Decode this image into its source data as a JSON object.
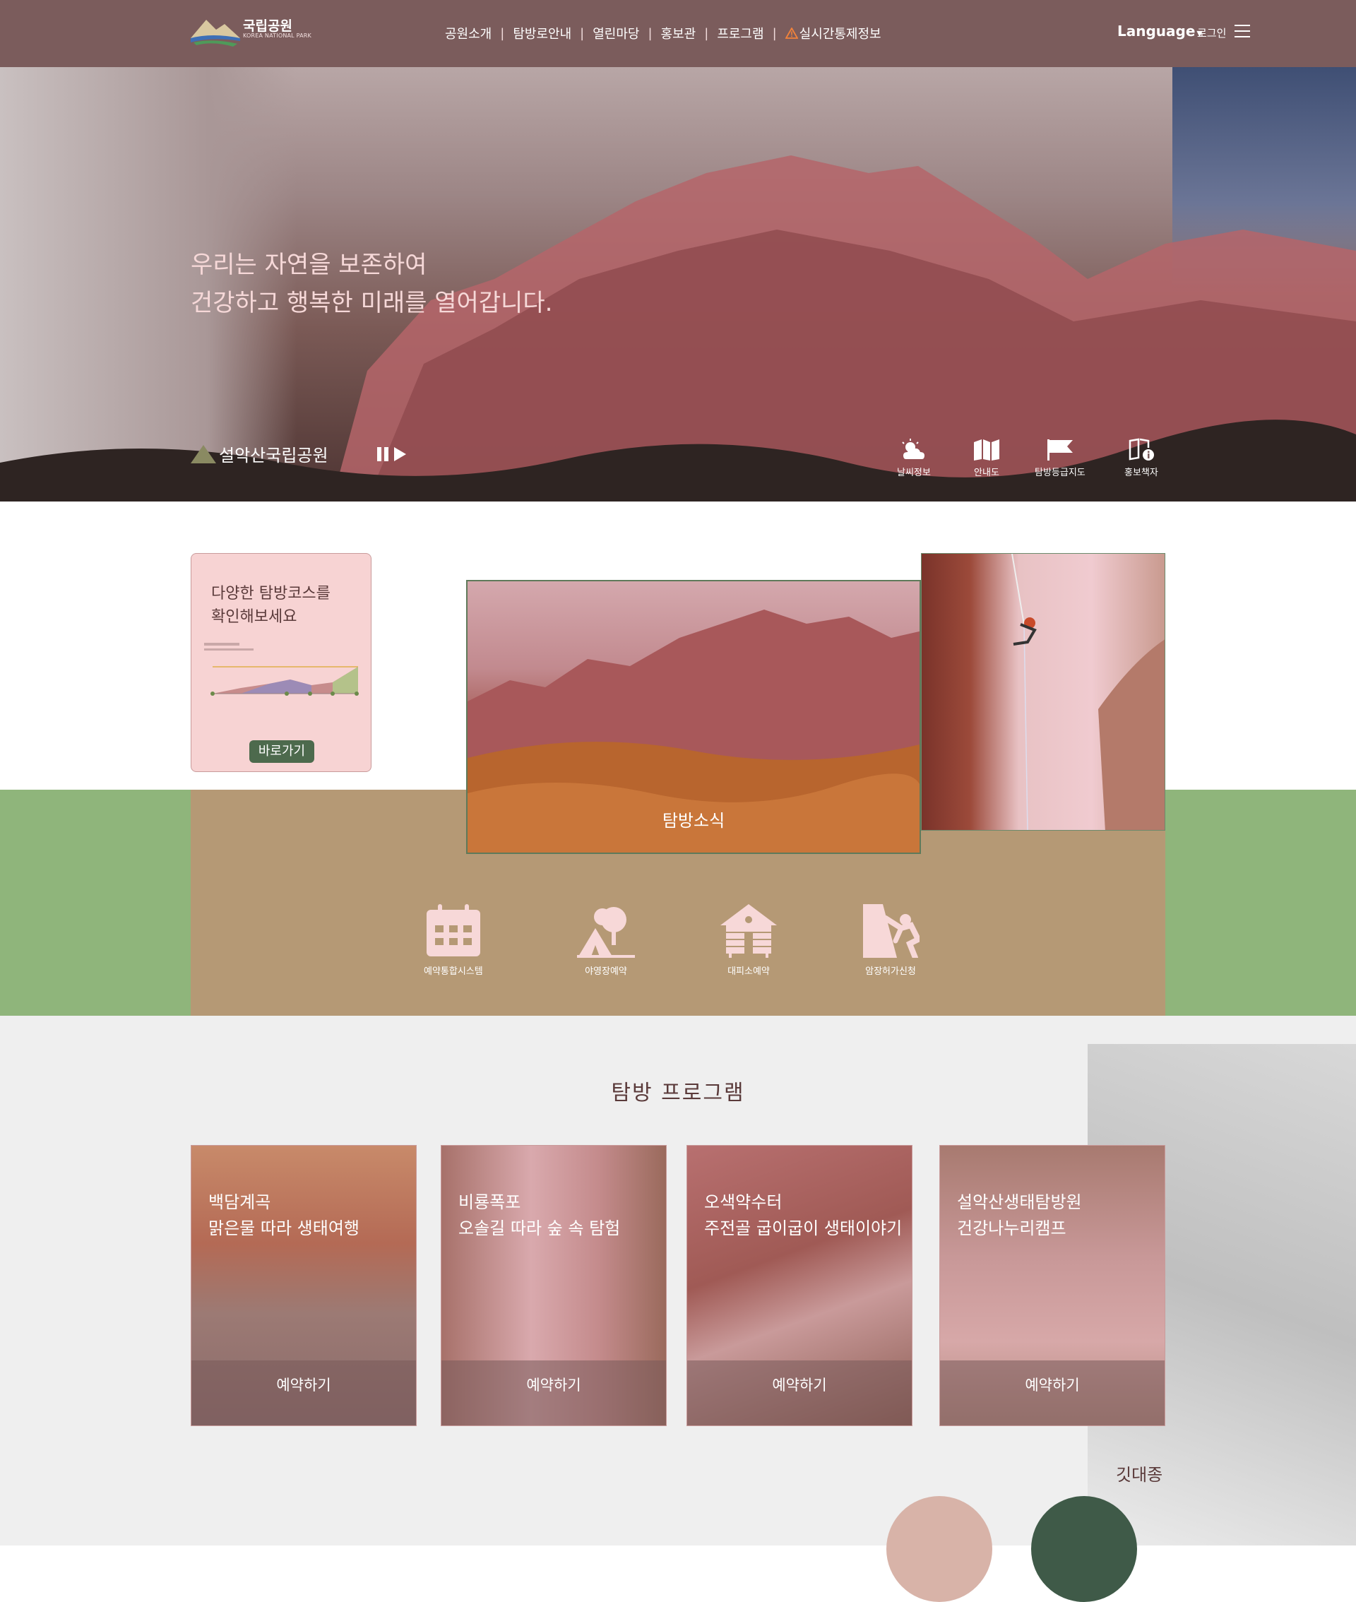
{
  "header": {
    "logo_kr": "국립공원",
    "logo_en": "KOREA NATIONAL PARK",
    "nav": [
      "공원소개",
      "탐방로안내",
      "열린마당",
      "홍보관",
      "프로그램"
    ],
    "nav_alert": "실시간통제정보",
    "language": "Language",
    "login": "로그인"
  },
  "hero": {
    "line1": "우리는 자연을 보존하여",
    "line2": "건강하고 행복한 미래를 열어갑니다.",
    "park_name": "설악산국립공원",
    "quick_links": [
      {
        "label": "날씨정보",
        "icon": "weather-icon"
      },
      {
        "label": "안내도",
        "icon": "map-icon"
      },
      {
        "label": "탐방등급지도",
        "icon": "flag-icon"
      },
      {
        "label": "홍보책자",
        "icon": "brochure-icon"
      }
    ]
  },
  "course": {
    "title_line1": "다양한 탐방코스를",
    "title_line2": "확인해보세요",
    "button": "바로가기"
  },
  "news": {
    "label": "탐방소식"
  },
  "services": [
    {
      "label": "예약통합시스템",
      "icon": "calendar-icon"
    },
    {
      "label": "야영장예약",
      "icon": "camping-icon"
    },
    {
      "label": "대피소예약",
      "icon": "shelter-icon"
    },
    {
      "label": "암장허가신청",
      "icon": "climbing-icon"
    }
  ],
  "programs": {
    "title": "탐방 프로그램",
    "items": [
      {
        "line1": "백담계곡",
        "line2": "맑은물 따라 생태여행",
        "button": "예약하기"
      },
      {
        "line1": "비룡폭포",
        "line2": "오솔길 따라 숲 속 탐험",
        "button": "예약하기"
      },
      {
        "line1": "오색약수터",
        "line2": "주전골 굽이굽이 생태이야기",
        "button": "예약하기"
      },
      {
        "line1": "설악산생태탐방원",
        "line2": "건강나누리캠프",
        "button": "예약하기"
      }
    ]
  },
  "featured": {
    "label": "깃대종"
  },
  "colors": {
    "header_bg": "#7b5c5c",
    "green_band": "#8fb57b",
    "button_green": "#4d6a4d",
    "alert": "#f2823a"
  }
}
